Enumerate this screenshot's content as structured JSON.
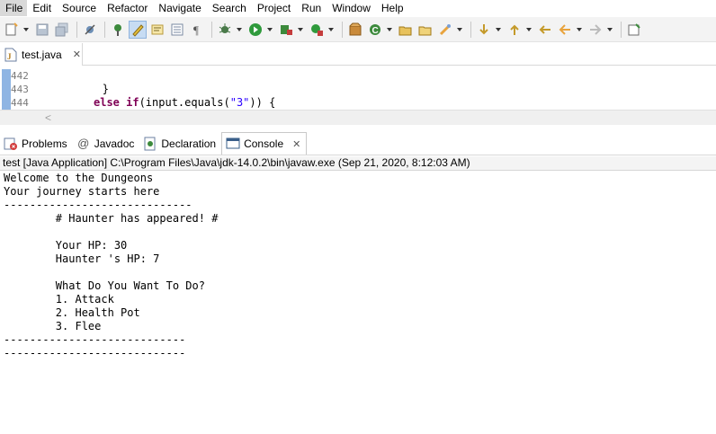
{
  "menu": [
    "File",
    "Edit",
    "Source",
    "Refactor",
    "Navigate",
    "Search",
    "Project",
    "Run",
    "Window",
    "Help"
  ],
  "toolbar": {
    "icons": [
      "new-icon",
      "save-icon",
      "save-all-icon",
      "skip-breakpoints-icon",
      "debug-icon",
      "mark-occurrences-icon",
      "open-task-icon",
      "open-element-icon",
      "show-whitespace-icon",
      "debug-run-icon",
      "run-icon",
      "coverage-icon",
      "external-tools-icon",
      "new-java-package-icon",
      "new-java-class-icon",
      "open-type-icon",
      "open-folder-icon",
      "search-icon",
      "next-annotation-icon",
      "previous-annotation-icon",
      "last-edit-icon",
      "back-icon",
      "forward-icon",
      "pin-editor-icon"
    ]
  },
  "editor": {
    "tab_label": "test.java",
    "tab_close": "✕",
    "lines": [
      {
        "number": "442",
        "text": ""
      },
      {
        "number": "443",
        "text": "        }"
      },
      {
        "number": "444",
        "kw": "else if",
        "rest_a": "(input.equals(",
        "str": "\"3\"",
        "rest_b": ")) {"
      }
    ],
    "scroll_left": "<"
  },
  "views": {
    "tabs": [
      {
        "label": "Problems",
        "icon": "problems-icon"
      },
      {
        "label": "Javadoc",
        "icon": "javadoc-icon"
      },
      {
        "label": "Declaration",
        "icon": "declaration-icon"
      },
      {
        "label": "Console",
        "icon": "console-icon",
        "close": "✕"
      }
    ]
  },
  "console": {
    "header": "test [Java Application] C:\\Program Files\\Java\\jdk-14.0.2\\bin\\javaw.exe  (Sep 21, 2020, 8:12:03 AM)",
    "lines": [
      "Welcome to the Dungeons",
      "Your journey starts here",
      "-----------------------------",
      "        # Haunter has appeared! #",
      "",
      "        Your HP: 30",
      "        Haunter 's HP: 7",
      "",
      "        What Do You Want To Do?",
      "        1. Attack",
      "        2. Health Pot",
      "        3. Flee",
      "----------------------------",
      "----------------------------"
    ]
  },
  "colors": {
    "keyword": "#7f0055",
    "string": "#2a00ff",
    "selection": "#c7dcf3"
  }
}
